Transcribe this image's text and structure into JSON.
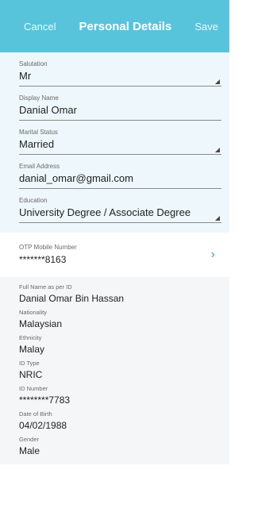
{
  "header": {
    "cancel": "Cancel",
    "title": "Personal Details",
    "save": "Save"
  },
  "form": {
    "salutation": {
      "label": "Salutation",
      "value": "Mr"
    },
    "display_name": {
      "label": "Display Name",
      "value": "Danial Omar"
    },
    "marital_status": {
      "label": "Marital Status",
      "value": "Married"
    },
    "email": {
      "label": "Email Address",
      "value": "danial_omar@gmail.com"
    },
    "education": {
      "label": "Education",
      "value": "University Degree / Associate Degree"
    }
  },
  "otp": {
    "label": "OTP Mobile Number",
    "value": "*******8163",
    "icon": "chevron-right-icon"
  },
  "identity": {
    "full_name": {
      "label": "Full Name as per ID",
      "value": "Danial Omar Bin Hassan"
    },
    "nationality": {
      "label": "Nationality",
      "value": "Malaysian"
    },
    "ethnicity": {
      "label": "Ethnicity",
      "value": "Malay"
    },
    "id_type": {
      "label": "ID Type",
      "value": "NRIC"
    },
    "id_number": {
      "label": "ID Number",
      "value": "********7783"
    },
    "dob": {
      "label": "Date of Birth",
      "value": "04/02/1988"
    },
    "gender": {
      "label": "Gender",
      "value": "Male"
    }
  },
  "colors": {
    "header_bg": "#57c4dc",
    "form_bg": "#eef7fb",
    "accent": "#3f9fbf"
  }
}
